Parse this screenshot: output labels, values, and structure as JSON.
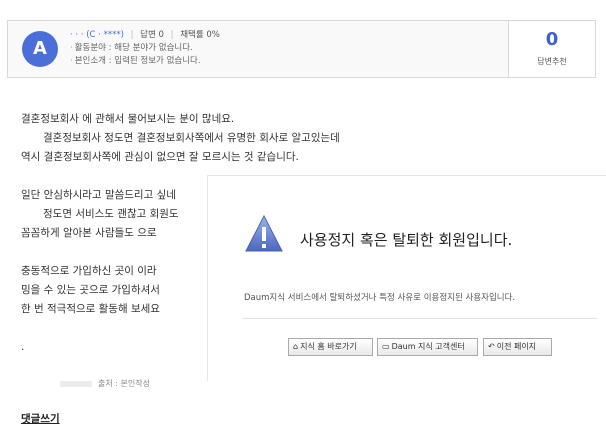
{
  "profile": {
    "avatar_letter": "A",
    "username": "· · · (C · ****)",
    "answers_label": "답변 0",
    "adopt_label": "채택률 0%",
    "field": "활동분야 : 해당 분야가 없습니다.",
    "intro": "본인소개 : 입력된 정보가 없습니다.",
    "recommend_count": "0",
    "recommend_label": "답변추천"
  },
  "answer": {
    "lines": [
      "결혼정보회사        에 관해서 물어보시는 분이 많네요.",
      "결혼정보회사 정도면 결혼정보회사쪽에서 유명한 회사로 알고있는데",
      "역시 결혼정보회사쪽에 관심이 없으면 잘 모르시는 것 같습니다.",
      "일단 안심하시라고 말씀드리고 싶네",
      "정도면 서비스도 괜찮고 회원도",
      "꼼꼼하게 알아본 사람들도        으로",
      "충동적으로 가입하신 곳이        이라",
      "밍을 수 있는 곳으로 가입하셔서",
      "한 번 적극적으로 활동해 보세요",
      "."
    ]
  },
  "source_text": "출처 : 본인작성",
  "comment_link": "댓글쓰기",
  "dialog": {
    "title": "사용정지 혹은 탈퇴한 회원입니다.",
    "description": "Daum지식 서비스에서 탈퇴하셨거나 특정 사유로 이용정지된 사용자입니다.",
    "buttons": [
      {
        "icon": "home-icon",
        "label": "지식 홈 바로가기"
      },
      {
        "icon": "window-icon",
        "label": "Daum 지식 고객센터"
      },
      {
        "icon": "back-arrow-icon",
        "label": "이전 페이지"
      }
    ]
  },
  "colors": {
    "avatar": "#4a6fd8",
    "recommend_number": "#3f62c9",
    "warning_icon": "#5b79c9"
  }
}
